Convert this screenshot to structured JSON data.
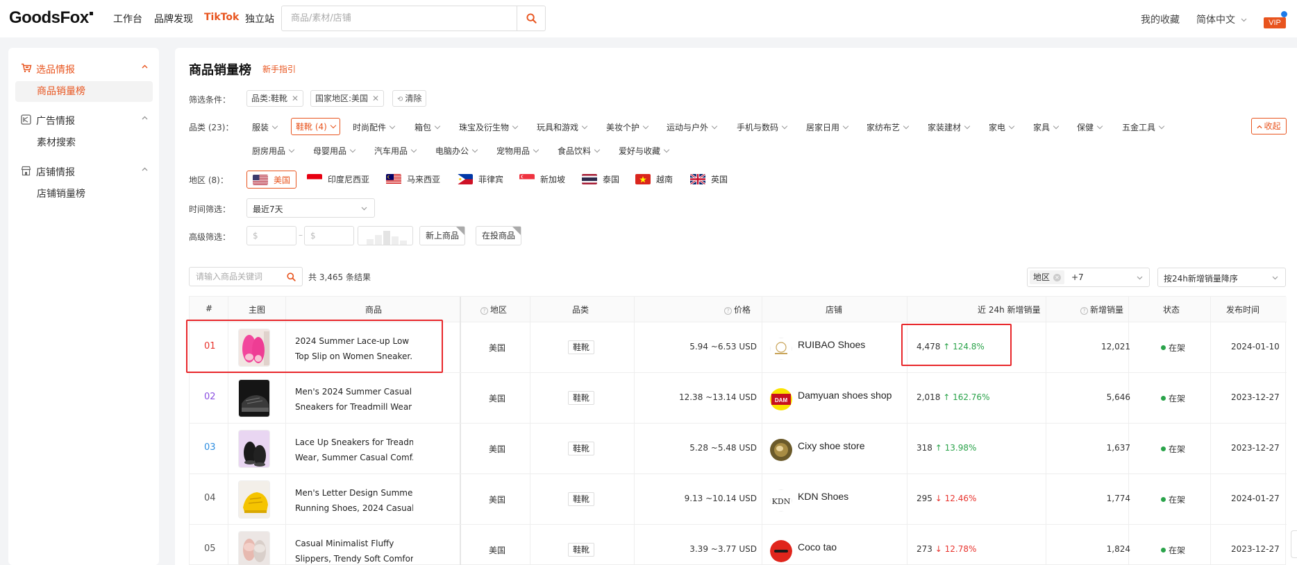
{
  "header": {
    "logo": "GoodsFox",
    "nav": [
      "工作台",
      "品牌发现",
      "TikTok",
      "独立站"
    ],
    "search_placeholder": "商品/素材/店铺",
    "favorites": "我的收藏",
    "language": "简体中文",
    "vip": "VIP"
  },
  "sidebar": {
    "groups": [
      {
        "label": "选品情报",
        "items": [
          "商品销量榜"
        ]
      },
      {
        "label": "广告情报",
        "items": [
          "素材搜索"
        ]
      },
      {
        "label": "店铺情报",
        "items": [
          "店铺销量榜"
        ]
      }
    ]
  },
  "page": {
    "title": "商品销量榜",
    "guide": "新手指引"
  },
  "filters": {
    "conditions_label": "筛选条件：",
    "active_tags": [
      "品类:鞋靴",
      "国家地区:美国"
    ],
    "clear_label": "清除",
    "category_label": "品类 (23)：",
    "categories_row1": [
      "服装",
      "鞋靴 (4)",
      "时尚配件",
      "箱包",
      "珠宝及衍生物",
      "玩具和游戏",
      "美妆个护",
      "运动与户外",
      "手机与数码",
      "居家日用",
      "家纺布艺",
      "家装建材",
      "家电",
      "家具",
      "保健",
      "五金工具"
    ],
    "categories_row2": [
      "厨房用品",
      "母婴用品",
      "汽车用品",
      "电脑办公",
      "宠物用品",
      "食品饮料",
      "爱好与收藏"
    ],
    "collapse_label": "收起",
    "region_label": "地区 (8)：",
    "regions": [
      "美国",
      "印度尼西亚",
      "马来西亚",
      "菲律宾",
      "新加坡",
      "泰国",
      "越南",
      "英国"
    ],
    "time_label": "时间筛选：",
    "time_value": "最近7天",
    "advanced_label": "高级筛选：",
    "price_min_placeholder": "$",
    "price_max_placeholder": "$",
    "new_products": "新上商品",
    "advertising_products": "在投商品"
  },
  "table_tools": {
    "search_placeholder": "请输入商品关键词",
    "result_count": "共 3,465 条结果",
    "region_select_label": "地区",
    "region_select_extra": "+7",
    "sort_value": "按24h新增销量降序"
  },
  "table": {
    "headers": [
      "#",
      "主图",
      "商品",
      "地区",
      "品类",
      "价格",
      "店铺",
      "近 24h 新增销量",
      "新增销量",
      "状态",
      "发布时间"
    ],
    "rows": [
      {
        "rank": "01",
        "name1": "2024 Summer Lace-up Low",
        "name2": "Top Slip on Women Sneaker...",
        "region": "美国",
        "category": "鞋靴",
        "price": "5.94 ~6.53 USD",
        "shop": "RUIBAO Shoes",
        "sales24": "4,478",
        "change": "124.8%",
        "trend": "up",
        "new_sales": "12,021",
        "status": "在架",
        "date": "2024-01-10"
      },
      {
        "rank": "02",
        "name1": "Men's 2024 Summer Casual",
        "name2": "Sneakers for Treadmill Wear ...",
        "region": "美国",
        "category": "鞋靴",
        "price": "12.38 ~13.14 USD",
        "shop": "Damyuan shoes shop",
        "sales24": "2,018",
        "change": "162.76%",
        "trend": "up",
        "new_sales": "5,646",
        "status": "在架",
        "date": "2023-12-27"
      },
      {
        "rank": "03",
        "name1": "Lace Up Sneakers for Treadmill",
        "name2": "Wear, Summer Casual Comf...",
        "region": "美国",
        "category": "鞋靴",
        "price": "5.28 ~5.48 USD",
        "shop": "Cixy shoe store",
        "sales24": "318",
        "change": "13.98%",
        "trend": "up",
        "new_sales": "1,637",
        "status": "在架",
        "date": "2023-12-27"
      },
      {
        "rank": "04",
        "name1": "Men's Letter Design Summer",
        "name2": "Running Shoes, 2024 Casual...",
        "region": "美国",
        "category": "鞋靴",
        "price": "9.13 ~10.14 USD",
        "shop": "KDN Shoes",
        "sales24": "295",
        "change": "12.46%",
        "trend": "down",
        "new_sales": "1,774",
        "status": "在架",
        "date": "2024-01-27"
      },
      {
        "rank": "05",
        "name1": "Casual Minimalist Fluffy",
        "name2": "Slippers, Trendy Soft Comfor...",
        "region": "美国",
        "category": "鞋靴",
        "price": "3.39 ~3.77 USD",
        "shop": "Coco tao",
        "sales24": "273",
        "change": "12.78%",
        "trend": "down",
        "new_sales": "1,824",
        "status": "在架",
        "date": "2023-12-27"
      }
    ]
  },
  "colors": {
    "accent": "#e8541e",
    "up": "#2aa34a",
    "down": "#e8342e",
    "highlight": "#e8262a",
    "rank_colors": [
      "#e8342e",
      "#8a4fe0",
      "#2f8ee0",
      "#555555",
      "#555555"
    ]
  }
}
